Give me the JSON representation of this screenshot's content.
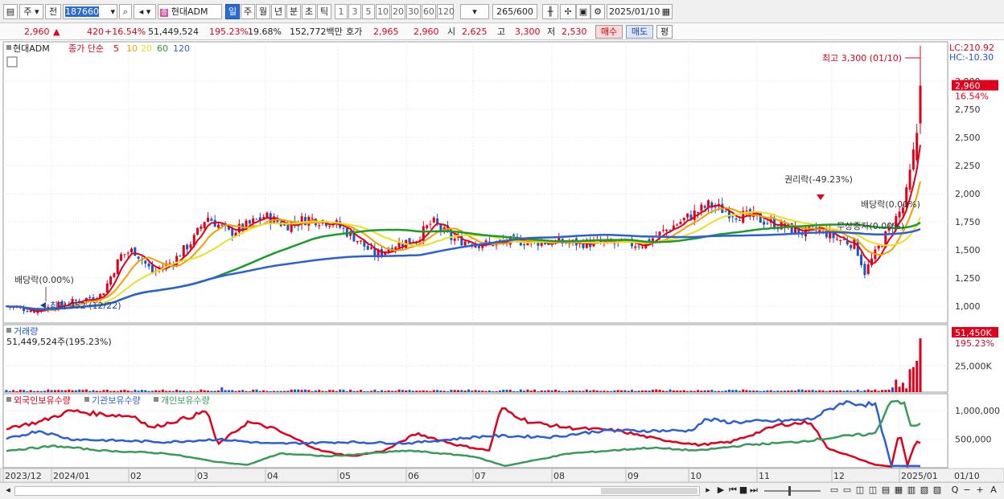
{
  "toolbar": {
    "period_type": "주",
    "prev_label": "전",
    "code": "187660",
    "name_badge": "종",
    "name": "현대ADM",
    "periods": [
      "일",
      "주",
      "월",
      "년",
      "분",
      "초",
      "틱"
    ],
    "active_period": "일",
    "intervals": [
      "1",
      "3",
      "5",
      "10",
      "20",
      "30",
      "60",
      "120"
    ],
    "count": "265",
    "count_total": "/600",
    "date": "2025/01/10"
  },
  "quote": {
    "price": "2,960",
    "arrow": "▲",
    "change": "420",
    "change_pct": "+16.54%",
    "volume": "51,449,524",
    "vol_ratio": "195.23%",
    "turnover": "19.68%",
    "amount": "152,772백만",
    "ask_label": "호가",
    "ask": "2,965",
    "bid": "2,960",
    "open_label": "시",
    "open": "2,625",
    "high_label": "고",
    "high": "3,300",
    "low_label": "저",
    "low": "2,530",
    "buy_label": "매수",
    "sell_label": "매도",
    "eval_label": "평"
  },
  "price_panel": {
    "legend_name": "현대ADM",
    "legend_ma_title": "종가 단순",
    "ma_periods": [
      "5",
      "10",
      "20",
      "60",
      "120"
    ],
    "ma_colors": [
      "#e0001b",
      "#f0a000",
      "#e8e020",
      "#1e9a2a",
      "#2d5fd4"
    ],
    "y_ticks": [
      "1,000",
      "1,250",
      "1,500",
      "1,750",
      "2,000",
      "2,250",
      "2,500",
      "2,750",
      "3,000"
    ],
    "lc": "LC:210.92",
    "hc": "HC:-10.30",
    "last_price": "2,960",
    "last_pct": "16.54%",
    "annotations": {
      "high": "최고 3,300 (01/10)",
      "low": "최저 952 (12/22)",
      "dividend1": "배당락(0.00%)",
      "rights": "권리락(-49.23%)",
      "dividend2": "배당락(0.00%)",
      "bonus": "무상증자(0.00%)"
    },
    "colors": {
      "up": "#e0001b",
      "down": "#1a56c8"
    }
  },
  "volume_panel": {
    "title": "거래량",
    "value": "51,449,524주(195.23%)",
    "y_tick": "25,000K",
    "last": "51,450K",
    "last_pct": "195.23%"
  },
  "holdings_panel": {
    "legends": [
      {
        "label": "외국인보유수량",
        "color": "#e0001b"
      },
      {
        "label": "기관보유수량",
        "color": "#2d5fd4"
      },
      {
        "label": "개인보유수량",
        "color": "#3a9a5a"
      }
    ],
    "y_ticks": [
      "500,000",
      "1,000,000"
    ]
  },
  "x_axis": {
    "labels": [
      "2023/12",
      "2024/01",
      "02",
      "03",
      "04",
      "05",
      "06",
      "07",
      "08",
      "09",
      "10",
      "11",
      "12",
      "2025/01"
    ],
    "right_label": "01/10"
  },
  "bottom": {
    "nav_icons": [
      "▶",
      "◀◀",
      "■",
      "▶▶"
    ],
    "zoom_icons": [
      "Q",
      "−",
      "+",
      "A"
    ]
  }
}
